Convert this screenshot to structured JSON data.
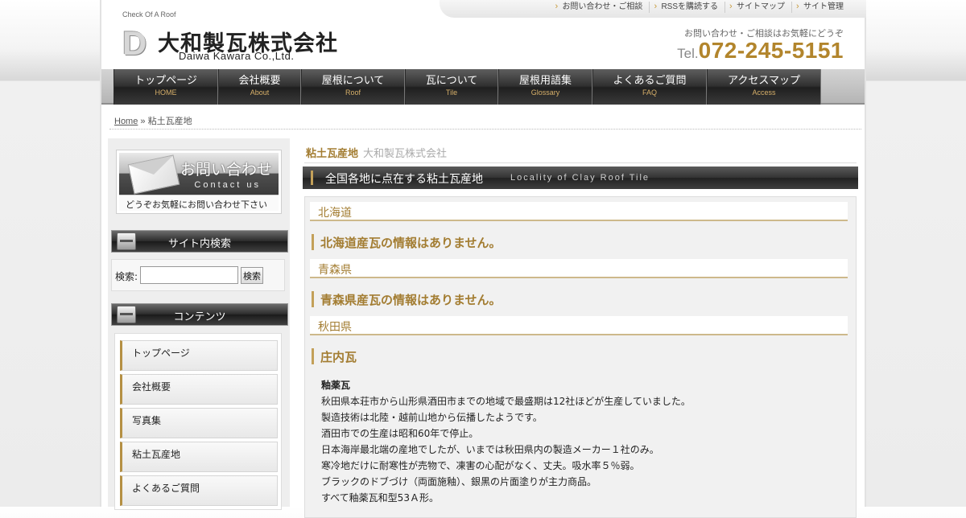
{
  "header": {
    "tagline": "Check Of A Roof",
    "toplinks": [
      "お問い合わせ・ご相談",
      "RSSを購読する",
      "サイトマップ",
      "サイト管理"
    ],
    "logo_letter": "D",
    "logo_jp": "大和製瓦株式会社",
    "logo_en": "Daiwa Kawara Co.,Ltd.",
    "contact_note": "お問い合わせ・ご相談はお気軽にどうぞ",
    "tel_prefix": "Tel.",
    "tel_number": "072-245-5151"
  },
  "nav": [
    {
      "jp": "トップページ",
      "en": "HOME"
    },
    {
      "jp": "会社概要",
      "en": "About"
    },
    {
      "jp": "屋根について",
      "en": "Roof"
    },
    {
      "jp": "瓦について",
      "en": "Tile"
    },
    {
      "jp": "屋根用語集",
      "en": "Glossary"
    },
    {
      "jp": "よくあるご質問",
      "en": "FAQ"
    },
    {
      "jp": "アクセスマップ",
      "en": "Access"
    }
  ],
  "breadcrumb": {
    "home": "Home",
    "sep": "»",
    "current": "粘土瓦産地"
  },
  "sidebar": {
    "contact_title": "お問い合わせ",
    "contact_sub": "Contact us",
    "contact_note": "どうぞお気軽にお問い合わせ下さい",
    "search_heading": "サイト内検索",
    "search_label": "検索:",
    "search_value": "",
    "search_button": "検索",
    "contents_heading": "コンテンツ",
    "menu": [
      "トップページ",
      "会社概要",
      "写真集",
      "粘土瓦産地",
      "よくあるご質問"
    ]
  },
  "main": {
    "title": "粘土瓦産地",
    "title_sub": "大和製瓦株式会社",
    "section_jp": "全国各地に点在する粘土瓦産地",
    "section_en": "Locality of Clay Roof Tile",
    "prefs": [
      {
        "name": "北海道",
        "heading": "北海道産瓦の情報はありません。"
      },
      {
        "name": "青森県",
        "heading": "青森県産瓦の情報はありません。"
      },
      {
        "name": "秋田県",
        "heading": "庄内瓦"
      }
    ],
    "body_title": "釉薬瓦",
    "body_lines": [
      "秋田県本荘市から山形県酒田市までの地域で最盛期は12社ほどが生産していました。",
      "製造技術は北陸・越前山地から伝播したようです。",
      "酒田市での生産は昭和60年で停止。",
      "日本海岸最北端の産地でしたが、いまでは秋田県内の製造メーカー１社のみ。",
      "寒冷地だけに耐寒性が売物で、凍害の心配がなく、丈夫。吸水率５％弱。",
      "ブラックのドブづけ（両面施釉）、銀黒の片面塗りが主力商品。",
      "すべて釉薬瓦和型53Ａ形。"
    ]
  }
}
